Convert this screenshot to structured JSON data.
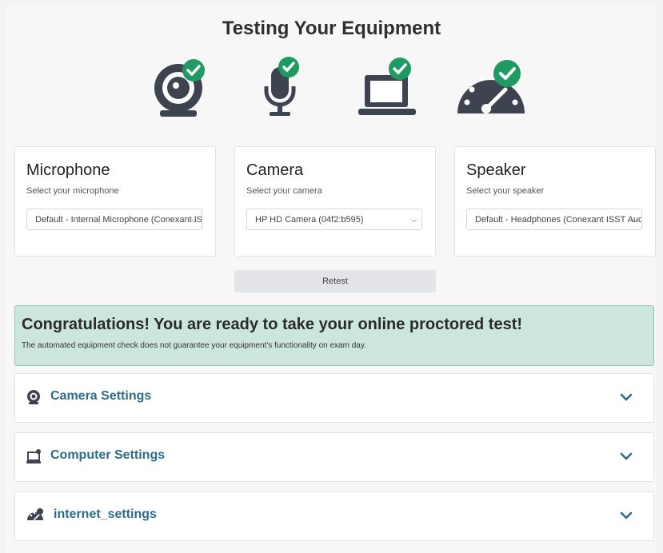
{
  "header": {
    "title": "Testing Your Equipment"
  },
  "status_icons": [
    {
      "name": "webcam-icon",
      "checked": true
    },
    {
      "name": "microphone-icon",
      "checked": true
    },
    {
      "name": "laptop-icon",
      "checked": true
    },
    {
      "name": "speedometer-icon",
      "checked": true
    }
  ],
  "devices": {
    "microphone": {
      "title": "Microphone",
      "subtitle": "Select your microphone",
      "selected": "Default - Internal Microphone (Conexant ISST Audio)"
    },
    "camera": {
      "title": "Camera",
      "subtitle": "Select your camera",
      "selected": "HP HD Camera (04f2:b595)"
    },
    "speaker": {
      "title": "Speaker",
      "subtitle": "Select your speaker",
      "selected": "Default - Headphones (Conexant ISST Audio)"
    }
  },
  "retest_label": "Retest",
  "banner": {
    "title": "Congratulations! You are ready to take your online proctored test!",
    "note": "The automated equipment check does not guarantee your equipment's functionality on exam day."
  },
  "sections": [
    {
      "label": "Camera Settings",
      "icon": "webcam-icon"
    },
    {
      "label": "Computer Settings",
      "icon": "computer-icon"
    },
    {
      "label": "internet_settings",
      "icon": "speedometer-icon"
    }
  ],
  "colors": {
    "check_green": "#1f9a63",
    "icon_dark": "#3d4450",
    "banner_bg": "#cde6dd",
    "section_label": "#2d6b8a"
  }
}
